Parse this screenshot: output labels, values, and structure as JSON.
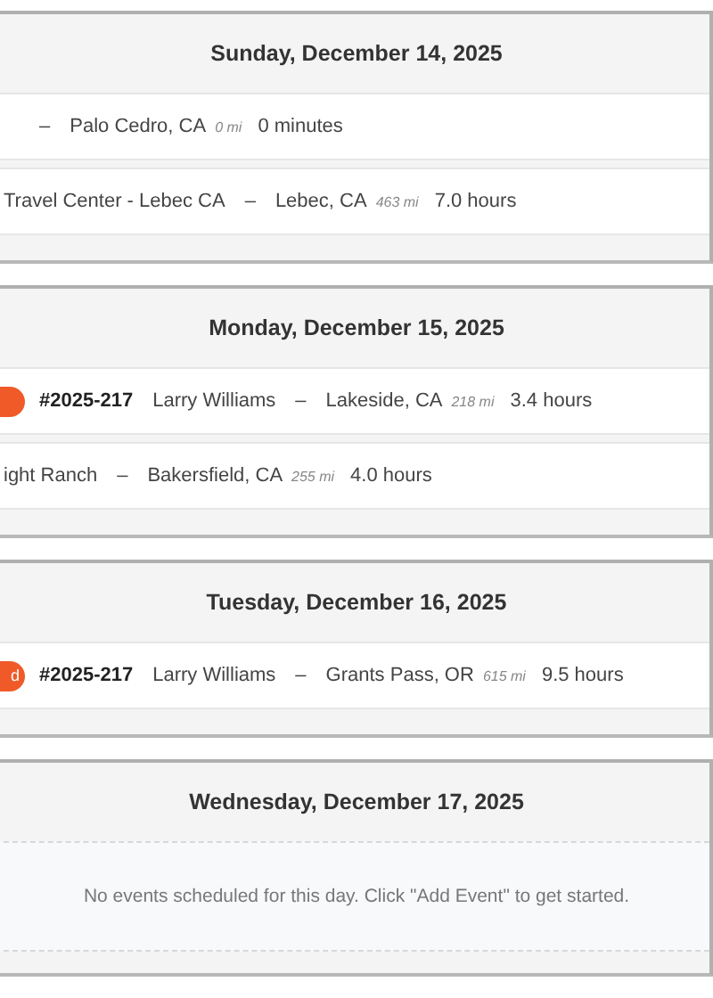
{
  "days": [
    {
      "date": "Sunday, December 14, 2025",
      "events": [
        {
          "separator": "–",
          "destination": "Palo Cedro, CA",
          "miles": "0 mi",
          "duration": "0 minutes"
        },
        {
          "origin": "Travel Center - Lebec CA",
          "separator": "–",
          "destination": "Lebec, CA",
          "miles": "463 mi",
          "duration": "7.0 hours"
        }
      ]
    },
    {
      "date": "Monday, December 15, 2025",
      "events": [
        {
          "badge": true,
          "order": "#2025-217",
          "origin": "Larry Williams",
          "separator": "–",
          "destination": "Lakeside, CA",
          "miles": "218 mi",
          "duration": "3.4 hours"
        },
        {
          "origin": "ight Ranch",
          "separator": "–",
          "destination": "Bakersfield, CA",
          "miles": "255 mi",
          "duration": "4.0 hours"
        }
      ]
    },
    {
      "date": "Tuesday, December 16, 2025",
      "events": [
        {
          "badge": true,
          "badge_text": "d",
          "order": "#2025-217",
          "origin": "Larry Williams",
          "separator": "–",
          "destination": "Grants Pass, OR",
          "miles": "615 mi",
          "duration": "9.5 hours"
        }
      ]
    },
    {
      "date": "Wednesday, December 17, 2025",
      "empty_message": "No events scheduled for this day. Click \"Add Event\" to get started."
    }
  ]
}
